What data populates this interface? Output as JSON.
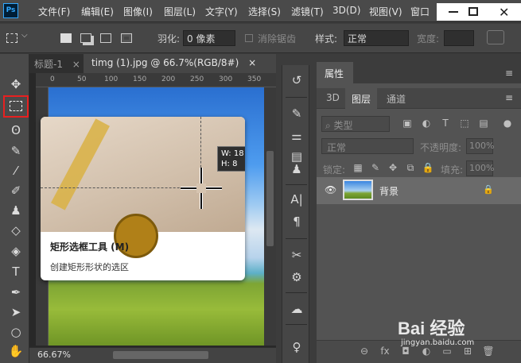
{
  "app": {
    "logo_text": "Ps"
  },
  "menu": {
    "items": [
      "文件(F)",
      "编辑(E)",
      "图像(I)",
      "图层(L)",
      "文字(Y)",
      "选择(S)",
      "滤镜(T)",
      "3D(D)",
      "视图(V)",
      "窗口"
    ]
  },
  "options_bar": {
    "feather_label": "羽化:",
    "feather_value": "0 像素",
    "antialias_label": "消除锯齿",
    "style_label": "样式:",
    "style_value": "正常",
    "width_label": "宽度:"
  },
  "doc_tabs": [
    {
      "label": "标题-1",
      "close": "×"
    },
    {
      "label": "timg (1).jpg @ 66.7%(RGB/8#)",
      "close": "×"
    }
  ],
  "ruler": {
    "top_marks": [
      "0",
      "50",
      "100",
      "150",
      "200",
      "250",
      "300",
      "350"
    ]
  },
  "status": {
    "zoom": "66.67%"
  },
  "tooltip": {
    "title": "矩形选框工具 (M)",
    "description": "创建矩形形状的选区",
    "readout_w": "W: 18",
    "readout_h": "H: 8"
  },
  "properties_panel": {
    "title": "属性",
    "menu_icon": "≡"
  },
  "layers_panel": {
    "tabs": [
      "3D",
      "图层",
      "通道"
    ],
    "active_tab": "图层",
    "filter_label": "类型",
    "blend_mode": "正常",
    "opacity_label": "不透明度:",
    "opacity_value": "100%",
    "lock_label": "锁定:",
    "fill_label": "填充:",
    "fill_value": "100%",
    "layers": [
      {
        "name": "背景",
        "visible": true,
        "locked": true
      }
    ]
  },
  "watermark": {
    "logo": "Bai 经验",
    "url": "jingyan.baidu.com"
  }
}
